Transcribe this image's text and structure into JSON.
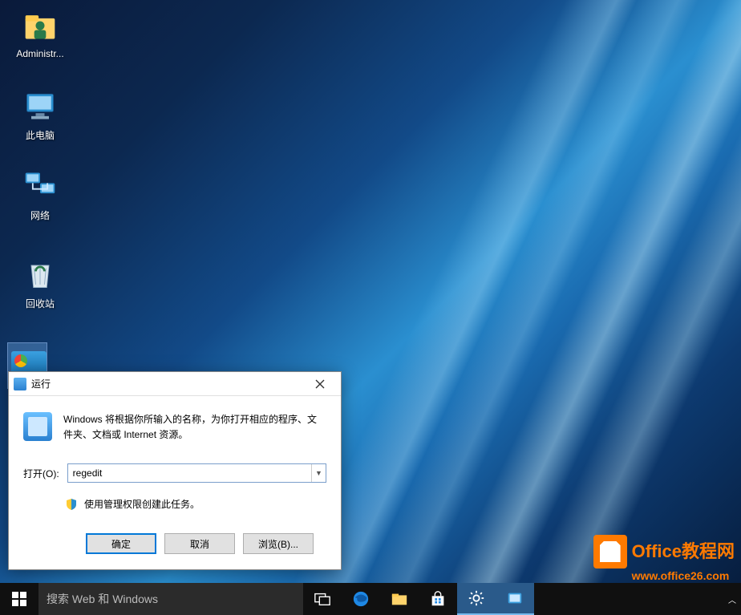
{
  "desktop": {
    "icons": [
      {
        "label": "Administr...",
        "type": "user"
      },
      {
        "label": "此电脑",
        "type": "pc"
      },
      {
        "label": "网络",
        "type": "network"
      },
      {
        "label": "回收站",
        "type": "recycle"
      },
      {
        "label": "",
        "type": "control"
      }
    ]
  },
  "run_dialog": {
    "title": "运行",
    "description": "Windows 将根据你所输入的名称，为你打开相应的程序、文件夹、文档或 Internet 资源。",
    "open_label": "打开(O):",
    "open_value": "regedit",
    "admin_note": "使用管理权限创建此任务。",
    "buttons": {
      "ok": "确定",
      "cancel": "取消",
      "browse": "浏览(B)..."
    }
  },
  "taskbar": {
    "search_placeholder": "搜索 Web 和 Windows"
  },
  "watermark": {
    "line1": "Office教程网",
    "line2": "www.office26.com"
  }
}
